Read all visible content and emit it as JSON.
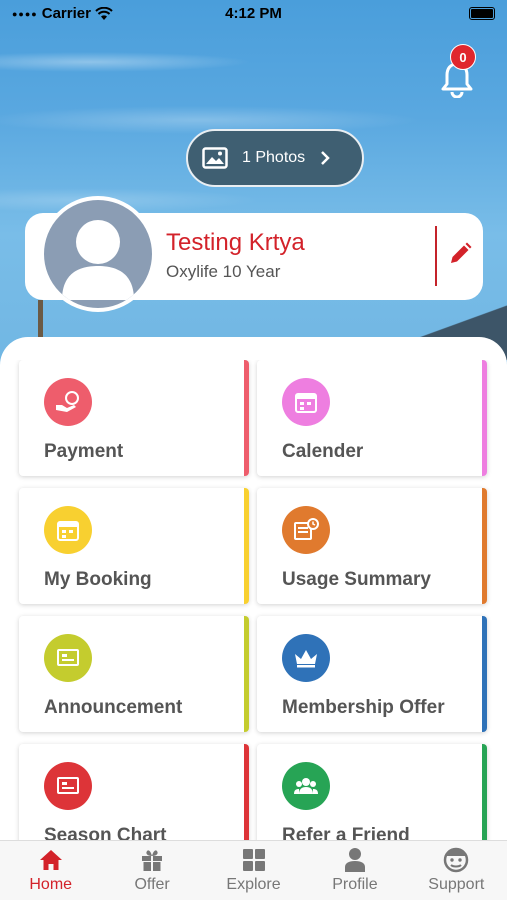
{
  "status_bar": {
    "carrier": "Carrier",
    "time": "4:12 PM"
  },
  "notifications": {
    "count": "0"
  },
  "photos": {
    "label": "1 Photos"
  },
  "profile": {
    "name": "Testing Krtya",
    "subtitle": "Oxylife 10 Year"
  },
  "tiles": [
    {
      "label": "Payment",
      "icon": "payment-icon",
      "color": "#ee5d6c"
    },
    {
      "label": "Calender",
      "icon": "calendar-icon",
      "color": "#ee7ee0"
    },
    {
      "label": "My Booking",
      "icon": "booking-icon",
      "color": "#f8d030"
    },
    {
      "label": "Usage Summary",
      "icon": "usage-summary-icon",
      "color": "#e07a2e"
    },
    {
      "label": "Announcement",
      "icon": "announcement-icon",
      "color": "#c4cc2e"
    },
    {
      "label": "Membership Offer",
      "icon": "crown-icon",
      "color": "#2f72b8"
    },
    {
      "label": "Season Chart",
      "icon": "season-chart-icon",
      "color": "#dd3438"
    },
    {
      "label": "Refer a Friend",
      "icon": "refer-friend-icon",
      "color": "#27a455"
    }
  ],
  "tabs": [
    {
      "label": "Home",
      "icon": "home-icon",
      "active": true
    },
    {
      "label": "Offer",
      "icon": "gift-icon",
      "active": false
    },
    {
      "label": "Explore",
      "icon": "explore-icon",
      "active": false
    },
    {
      "label": "Profile",
      "icon": "profile-icon",
      "active": false
    },
    {
      "label": "Support",
      "icon": "support-icon",
      "active": false
    }
  ],
  "colors": {
    "accent": "#d3222a",
    "pill": "#3f5f72",
    "tab_inactive": "#777777"
  }
}
